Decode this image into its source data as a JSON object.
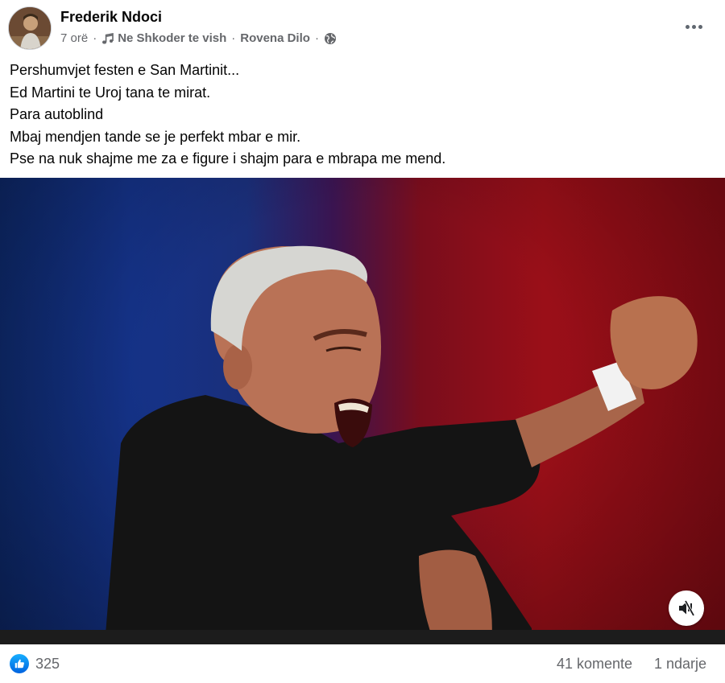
{
  "post": {
    "author": "Frederik Ndoci",
    "time": "7 orë",
    "separator": "·",
    "song": "Ne Shkoder te vish",
    "song_artist": "Rovena Dilo",
    "privacy_icon": "globe-icon",
    "music_icon": "music-note-icon",
    "more_icon": "more-horizontal-icon",
    "text_lines": [
      "Pershumvjet festen e San Martinit...",
      "Ed Martini te Uroj tana te mirat.",
      "Para autoblind",
      "Mbaj mendjen tande se je perfekt mbar e mir.",
      "Pse na nuk shajme me za e figure i shajm para e mbrapa me mend."
    ]
  },
  "media": {
    "type": "video",
    "mute_icon": "speaker-muted-icon",
    "colors": {
      "left": "#15338a",
      "right": "#9a0f18"
    }
  },
  "footer": {
    "reaction_icon": "like-icon",
    "reaction_count": "325",
    "comments": "41 komente",
    "shares": "1 ndarje"
  },
  "colors": {
    "accent": "#1877f2",
    "secondary_text": "#65676b",
    "primary_text": "#050505"
  }
}
